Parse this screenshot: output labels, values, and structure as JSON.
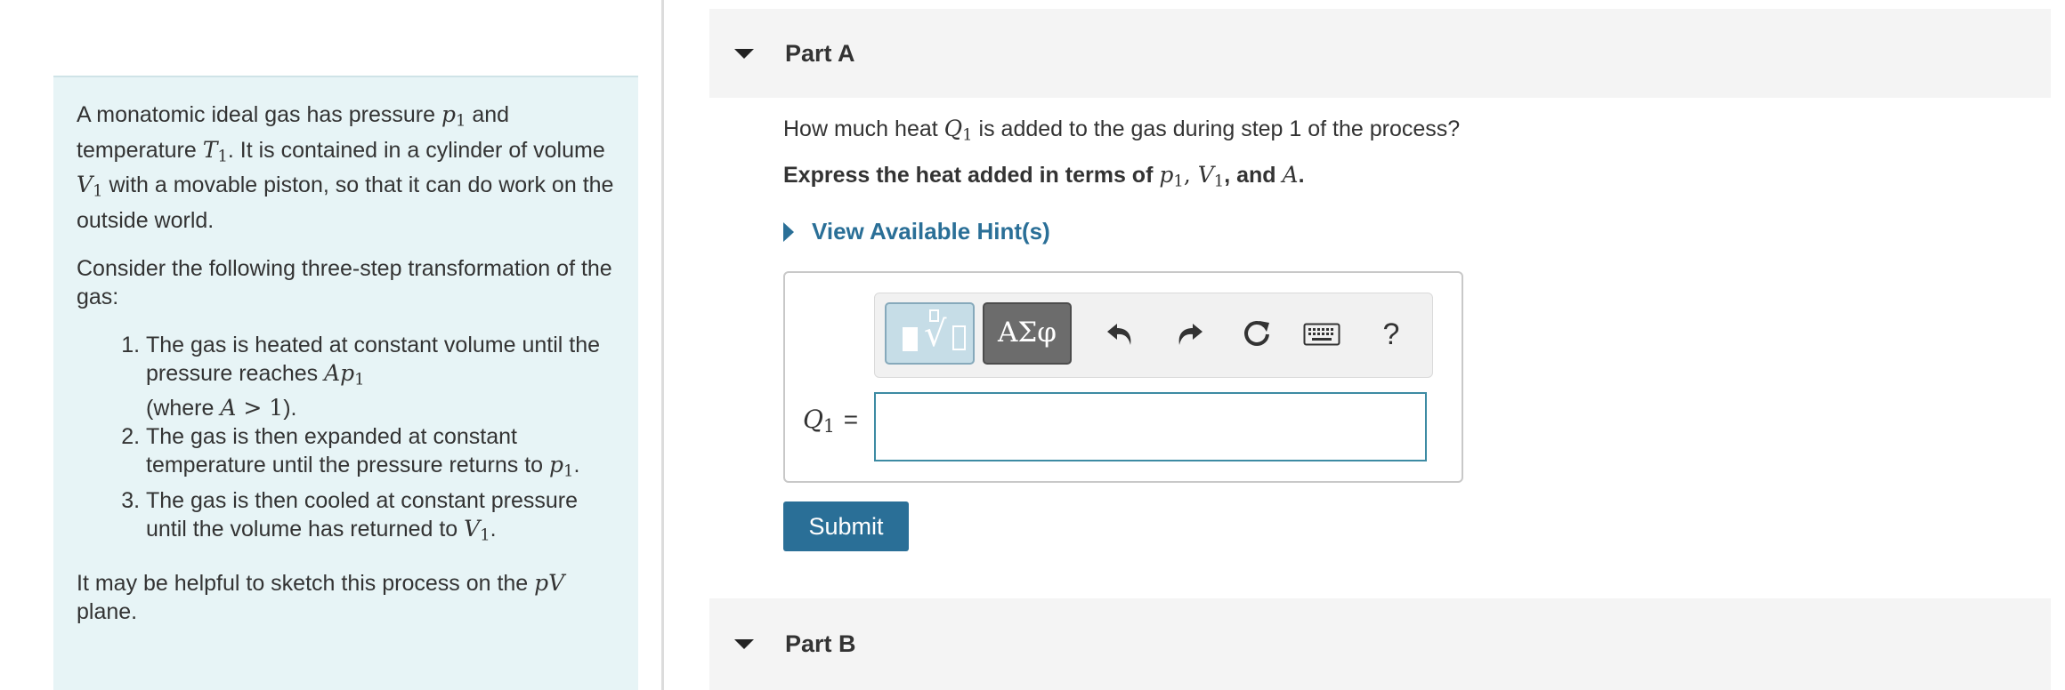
{
  "problem": {
    "intro": {
      "t1": "A monatomic ideal gas has pressure ",
      "v1": "p",
      "s1": "1",
      "t2": " and temperature ",
      "v2": "T",
      "s2": "1",
      "t3": ". It is contained in a cylinder of volume ",
      "v3": "V",
      "s3": "1",
      "t4": " with a movable piston, so that it can do work on the outside world."
    },
    "consider": "Consider the following three-step transformation of the gas:",
    "steps": [
      {
        "text": "The gas is heated at constant volume until the pressure reaches ",
        "math": "Ap",
        "sub": "1",
        "text2": "(where ",
        "math2": "A",
        "math3": " > 1",
        "text3": ")."
      },
      {
        "text": "The gas is then expanded at constant temperature until the pressure returns to ",
        "math": "p",
        "sub": "1",
        "text2": "."
      },
      {
        "text": "The gas is then cooled at constant pressure until the volume has returned to ",
        "math": "V",
        "sub": "1",
        "text2": "."
      }
    ],
    "sketch": {
      "t1": "It may be helpful to sketch this process on the ",
      "v": "pV",
      "t2": " plane."
    }
  },
  "part_a": {
    "title": "Part A",
    "question": {
      "t1": "How much heat ",
      "v": "Q",
      "s": "1",
      "t2": " is added to the gas during step 1 of the process?"
    },
    "instruction": {
      "t1": "Express the heat added in terms of ",
      "v1": "p",
      "s1": "1",
      "c1": ", ",
      "v2": "V",
      "s2": "1",
      "t2": ", and ",
      "v3": "A",
      "t3": "."
    },
    "hints_label": "View Available Hint(s)",
    "toolbar": {
      "greek": "ΑΣφ",
      "help": "?"
    },
    "answer": {
      "var": "Q",
      "sub": "1",
      "equals": "=",
      "value": ""
    },
    "submit_label": "Submit"
  },
  "part_b": {
    "title": "Part B"
  },
  "colors": {
    "panel_bg": "#e7f4f6",
    "accent": "#2a6f97",
    "header_bg": "#f4f4f4"
  }
}
